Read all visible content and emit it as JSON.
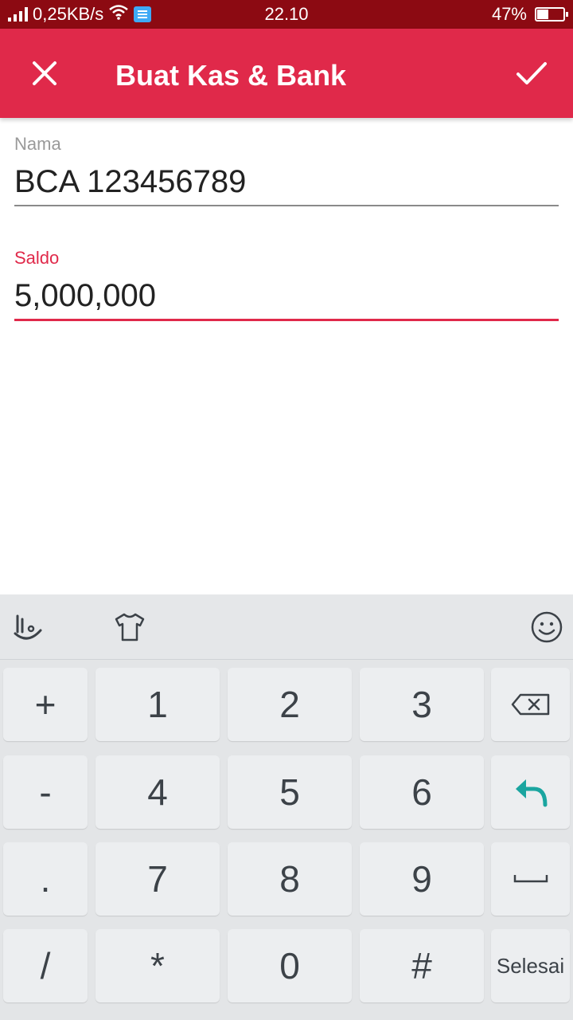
{
  "status_bar": {
    "network_speed": "0,25KB/s",
    "time": "22.10",
    "battery": "47%"
  },
  "app_bar": {
    "title": "Buat Kas & Bank",
    "close_icon": "close-icon",
    "confirm_icon": "check-icon"
  },
  "form": {
    "name": {
      "label": "Nama",
      "value": "BCA 123456789"
    },
    "balance": {
      "label": "Saldo",
      "value": "5,000,000"
    }
  },
  "keyboard": {
    "toolbar_icons": [
      "touchpal-icon",
      "theme-shirt-icon",
      "emoji-icon"
    ],
    "rows": [
      [
        "+",
        "1",
        "2",
        "3",
        "backspace"
      ],
      [
        "-",
        "4",
        "5",
        "6",
        "enter"
      ],
      [
        ".",
        "7",
        "8",
        "9",
        "space"
      ],
      [
        "/",
        "*",
        "0",
        "#",
        "Selesai"
      ]
    ]
  },
  "colors": {
    "status_bar": "#8c0a12",
    "primary": "#e0294a",
    "enter_key": "#1aa5a0"
  }
}
